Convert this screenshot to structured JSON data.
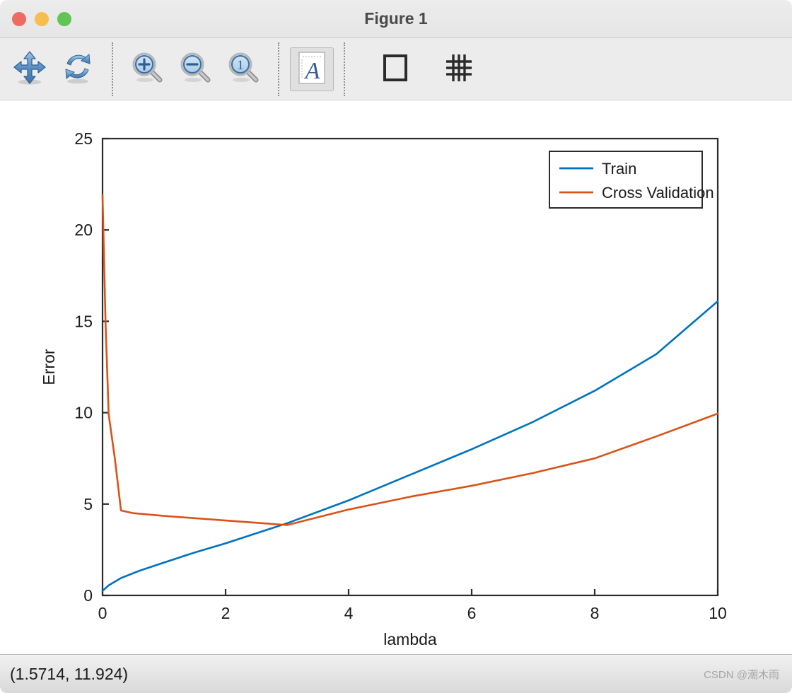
{
  "window": {
    "title": "Figure 1",
    "traffic_lights": [
      {
        "name": "close",
        "color": "#ed6b60"
      },
      {
        "name": "minimize",
        "color": "#f5be4f"
      },
      {
        "name": "maximize",
        "color": "#61c454"
      }
    ]
  },
  "toolbar": {
    "buttons": [
      {
        "icon": "pan-move-icon",
        "label": "Pan"
      },
      {
        "icon": "rotate-refresh-icon",
        "label": "Rotate 3D"
      },
      {
        "icon": "zoom-in-icon",
        "label": "Zoom In"
      },
      {
        "icon": "zoom-out-icon",
        "label": "Zoom Out"
      },
      {
        "icon": "zoom-reset-icon",
        "label": "Restore View"
      },
      {
        "icon": "text-annotation-icon",
        "label": "Insert Text"
      },
      {
        "icon": "box-outline-icon",
        "label": "Axes Box"
      },
      {
        "icon": "grid-icon",
        "label": "Grid"
      }
    ]
  },
  "statusbar": {
    "coordinates": "(1.5714, 11.924)",
    "watermark": "CSDN @潮木雨"
  },
  "chart_data": {
    "type": "line",
    "title": "",
    "xlabel": "lambda",
    "ylabel": "Error",
    "xlim": [
      0,
      10
    ],
    "ylim": [
      0,
      25
    ],
    "xticks": [
      0,
      2,
      4,
      6,
      8,
      10
    ],
    "yticks": [
      0,
      5,
      10,
      15,
      20,
      25
    ],
    "grid": false,
    "legend_position": "top-right",
    "series": [
      {
        "name": "Train",
        "color": "#0072BD",
        "x": [
          0,
          0.1,
          0.3,
          0.6,
          1.0,
          1.5,
          2.0,
          2.5,
          3.0,
          4.0,
          5.0,
          6.0,
          7.0,
          8.0,
          9.0,
          10.0
        ],
        "values": [
          0.25,
          0.55,
          0.95,
          1.35,
          1.8,
          2.35,
          2.85,
          3.4,
          3.95,
          5.2,
          6.6,
          8.0,
          9.5,
          11.2,
          13.2,
          16.1
        ]
      },
      {
        "name": "Cross Validation",
        "color": "#D95319",
        "x": [
          0,
          0.05,
          0.1,
          0.2,
          0.3,
          0.5,
          1.0,
          2.0,
          3.0,
          4.0,
          5.0,
          6.0,
          7.0,
          8.0,
          9.0,
          10.0
        ],
        "values": [
          21.9,
          14.8,
          9.9,
          7.5,
          4.65,
          4.5,
          4.35,
          4.1,
          3.85,
          4.7,
          5.4,
          6.0,
          6.7,
          7.5,
          8.7,
          9.95
        ]
      }
    ]
  }
}
